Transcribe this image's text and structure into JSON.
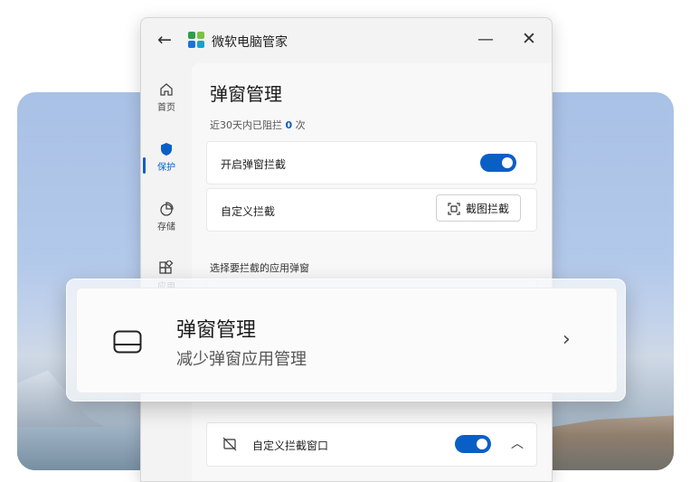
{
  "window": {
    "title": "微软电脑管家"
  },
  "nav": {
    "items": [
      {
        "label": "首页",
        "icon": "home-icon"
      },
      {
        "label": "保护",
        "icon": "shield-icon",
        "active": true
      },
      {
        "label": "存储",
        "icon": "pie-chart-icon"
      },
      {
        "label": "应用",
        "icon": "apps-icon"
      }
    ]
  },
  "page": {
    "title": "弹窗管理",
    "stat_prefix": "近30天内已阻拦",
    "stat_count": "0",
    "stat_suffix": "次",
    "enable_label": "开启弹窗拦截",
    "custom_label": "自定义拦截",
    "capture_button": "截图拦截",
    "section_label": "选择要拦截的应用弹窗",
    "custom_window_label": "自定义拦截窗口"
  },
  "overlay": {
    "title": "弹窗管理",
    "subtitle": "减少弹窗应用管理"
  },
  "colors": {
    "accent": "#0a5fc7"
  }
}
